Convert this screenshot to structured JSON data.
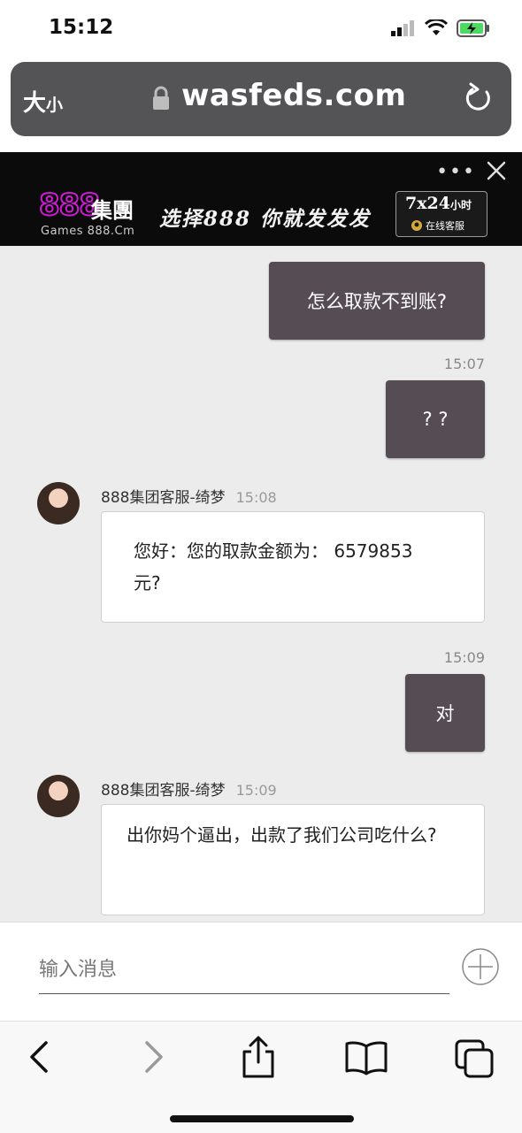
{
  "status_bar": {
    "time": "15:12"
  },
  "browser": {
    "text_size_label": "大",
    "text_size_small": "小",
    "url": "wasfeds.com"
  },
  "ad": {
    "logo_number": "888",
    "logo_group": "集團",
    "logo_sub": "Games 888.Cm",
    "slogan": "选择888 你就发发发",
    "badge_main": "7x24",
    "badge_unit": "小时",
    "badge_service": "在线客服"
  },
  "chat": {
    "messages": [
      {
        "type": "out",
        "text": "怎么取款不到账?"
      },
      {
        "type": "out",
        "time": "15:07",
        "text": "? ?"
      },
      {
        "type": "in",
        "sender": "888集团客服-绮梦",
        "time": "15:08",
        "lines": [
          "您好：您的取款金额为：  6579853",
          "元?"
        ]
      },
      {
        "type": "out",
        "time": "15:09",
        "text": "对"
      },
      {
        "type": "in",
        "sender": "888集团客服-绮梦",
        "time": "15:09",
        "lines": [
          "出你妈个逼出，出款了我们公司吃什么?"
        ]
      }
    ]
  },
  "input": {
    "placeholder": "输入消息"
  }
}
